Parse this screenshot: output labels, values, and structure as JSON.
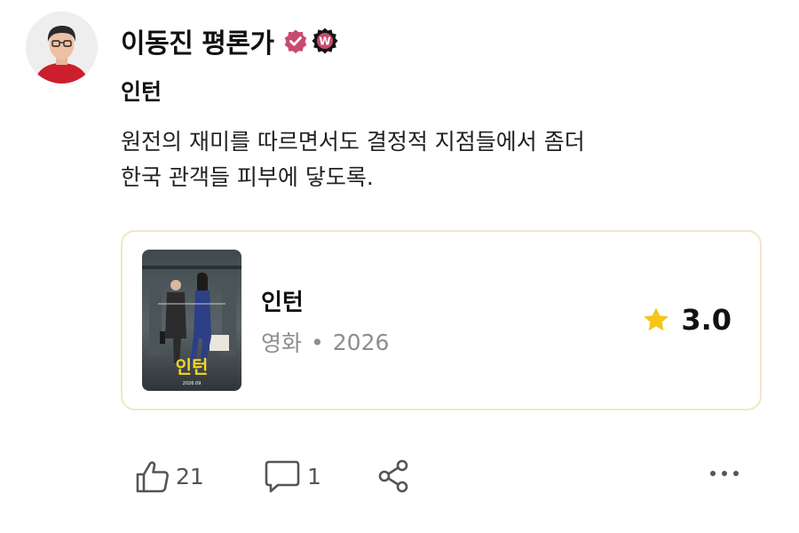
{
  "author": {
    "name": "이동진 평론가",
    "verified_icon": "verified-badge-icon",
    "badge_letter": "W",
    "accent_color": "#c84a6e"
  },
  "post": {
    "title": "인턴",
    "body_lines": [
      "원전의 재미를 따르면서도 결정적 지점들에서 좀더",
      "한국 관객들 피부에 닿도록."
    ]
  },
  "card": {
    "title": "인턴",
    "category": "영화",
    "separator": "•",
    "year": "2026",
    "rating": "3.0",
    "star_color": "#f5c518",
    "poster": {
      "title_text": "인턴",
      "date_text": "2026.09"
    }
  },
  "actions": {
    "likes": "21",
    "comments": "1"
  }
}
